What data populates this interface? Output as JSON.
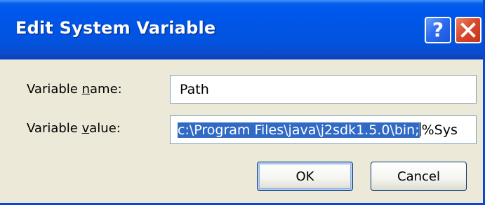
{
  "window": {
    "title": "Edit System Variable",
    "help_glyph": "?",
    "close_icon": "close-icon",
    "colors": {
      "titlebar": "#0055e5",
      "dialog_background": "#ece9d8",
      "selection": "#316ac5",
      "close_button": "#d8472a"
    }
  },
  "form": {
    "name_label_prefix": "Variable ",
    "name_label_accel": "n",
    "name_label_suffix": "ame:",
    "name_value": "Path",
    "value_label_prefix": "Variable ",
    "value_label_accel": "v",
    "value_label_suffix": "alue:",
    "value_selected": "c:\\Program Files\\java\\j2sdk1.5.0\\bin;",
    "value_rest": "%Sys"
  },
  "buttons": {
    "ok_label": "OK",
    "cancel_label": "Cancel"
  }
}
